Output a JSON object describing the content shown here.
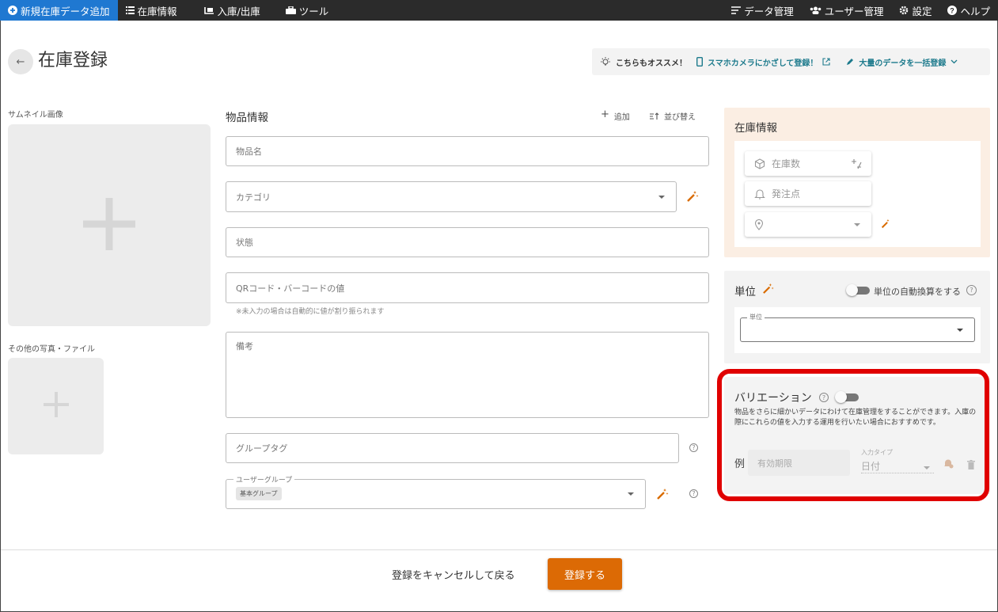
{
  "nav": {
    "new_item": "新規在庫データ追加",
    "inventory": "在庫情報",
    "in_out": "入庫/出庫",
    "tools": "ツール",
    "data_mgmt": "データ管理",
    "user_mgmt": "ユーザー管理",
    "settings": "設定",
    "help": "ヘルプ"
  },
  "page": {
    "title": "在庫登録"
  },
  "promo": {
    "recommend": "こちらもオススメ！",
    "camera": "スマホカメラにかざして登録！",
    "bulk": "大量のデータを一括登録"
  },
  "left": {
    "thumbnail_label": "サムネイル画像",
    "other_label": "その他の写真・ファイル"
  },
  "item_info": {
    "section": "物品情報",
    "add": "追加",
    "sort": "並び替え",
    "name_ph": "物品名",
    "category_ph": "カテゴリ",
    "status_ph": "状態",
    "qr_ph": "QRコード・バーコードの値",
    "qr_note": "※未入力の場合は自動的に値が割り振られます",
    "memo_ph": "備考",
    "group_tag_ph": "グループタグ",
    "user_group_legend": "ユーザーグループ",
    "user_group_chip": "基本グループ"
  },
  "stock": {
    "section": "在庫情報",
    "qty_ph": "在庫数",
    "reorder_ph": "発注点"
  },
  "unit": {
    "section": "単位",
    "auto_convert": "単位の自動換算をする",
    "field_legend": "単位"
  },
  "variation": {
    "title": "バリエーション",
    "desc": "物品をさらに細かいデータにわけて在庫管理をすることができます。入庫の際にこれらの値を入力する運用を行いたい場合におすすめです。",
    "example": "例",
    "example_ph": "有効期限",
    "type_legend": "入力タイプ",
    "type_value": "日付"
  },
  "footer": {
    "cancel": "登録をキャンセルして戻る",
    "submit": "登録する"
  },
  "colors": {
    "accent": "#dc6a05",
    "nav_active": "#1f78d1",
    "stock_panel": "#fbeee3",
    "highlight": "#e00000"
  }
}
